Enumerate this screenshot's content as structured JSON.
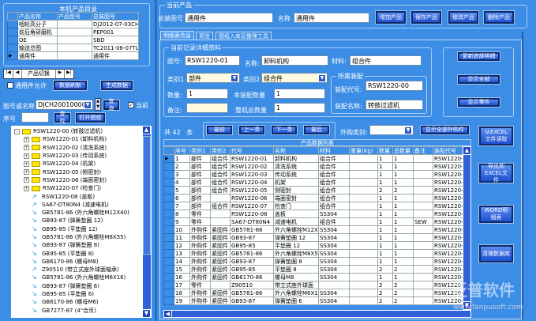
{
  "product_catalog": {
    "title": "本机产品目录",
    "headers": [
      "产品名称",
      "产品型号",
      "总装图号"
    ],
    "rows": [
      [
        "咽轮高分子",
        "",
        "DJ2012-07-03CH"
      ],
      [
        "前后角研磨机",
        "",
        "PEP001"
      ],
      [
        "OE",
        "",
        "SBD"
      ],
      [
        "输送总图",
        "",
        "TC2011-06-07TL"
      ],
      [
        "通用件",
        "",
        "通用件"
      ]
    ]
  },
  "nav": {
    "label": "产品切换",
    "first": "|◀",
    "prev": "◀",
    "next": "▶",
    "last": "▶|"
  },
  "common_parts": {
    "checkbox_label": "通用件允许",
    "checked": false,
    "refresh": "数据刷新",
    "generate": "生成数据"
  },
  "search": {
    "label": "图号或名称",
    "value": "DJCH20010000",
    "query": "查询",
    "current_label": "当前",
    "current_checked": true,
    "seq_label": "序号",
    "seq_value": "",
    "find": "查找",
    "open_drawing": "打开图纸"
  },
  "tree": [
    {
      "t": "folder",
      "exp": "-",
      "d": 0,
      "text": "RSW1220-00 (转鼓过滤机)"
    },
    {
      "t": "folder",
      "exp": "+",
      "d": 1,
      "text": "RSW1220-01 (卸料机构)"
    },
    {
      "t": "folder",
      "exp": "+",
      "d": 1,
      "text": "RSW1220-02 (清洗系统)"
    },
    {
      "t": "folder",
      "exp": "+",
      "d": 1,
      "text": "RSW1220-03 (传动系统)"
    },
    {
      "t": "folder",
      "exp": "+",
      "d": 1,
      "text": "RSW1220-04 (机架)"
    },
    {
      "t": "folder",
      "exp": "+",
      "d": 1,
      "text": "RSW1220-05 (侧密封)"
    },
    {
      "t": "folder",
      "exp": "+",
      "d": 1,
      "text": "RSW1220-06 (端面密封)"
    },
    {
      "t": "folder",
      "exp": "+",
      "d": 1,
      "text": "RSW1220-07 (检查门)"
    },
    {
      "t": "part",
      "d": 1,
      "text": "RSW1220-08 (盖板)"
    },
    {
      "t": "part",
      "d": 1,
      "text": "SA67-DT80N4 (减速电机)"
    },
    {
      "t": "std",
      "d": 1,
      "text": "GB5781-86 (外六角螺栓M12X40)"
    },
    {
      "t": "std",
      "d": 1,
      "text": "GB93-87 (弹簧垫圈 12)"
    },
    {
      "t": "std",
      "d": 1,
      "text": "GB95-85 (平垫圈 12)"
    },
    {
      "t": "std",
      "d": 1,
      "text": "GB5781-86 (外六角螺栓M8X55)"
    },
    {
      "t": "std",
      "d": 1,
      "text": "GB93-87 (弹簧垫圈 8)"
    },
    {
      "t": "std",
      "d": 1,
      "text": "GB95-85 (平垫圈 8)"
    },
    {
      "t": "std",
      "d": 1,
      "text": "GB6170-86 (螺母M8)"
    },
    {
      "t": "part",
      "d": 1,
      "text": "Z90510 (带立式座外球面轴承)"
    },
    {
      "t": "std",
      "d": 1,
      "text": "GB5781-86 (外六角螺栓M6X16)"
    },
    {
      "t": "std",
      "d": 1,
      "text": "GB93-87 (弹簧垫圈 6)"
    },
    {
      "t": "std",
      "d": 1,
      "text": "GB95-85 (平垫圈 6)"
    },
    {
      "t": "std",
      "d": 1,
      "text": "GB6170-86 (螺母M6)"
    },
    {
      "t": "std",
      "d": 1,
      "text": "GB7277-87 (4\"合页)"
    }
  ],
  "current_product": {
    "title": "当前产品",
    "drawing_label": "总装图号",
    "drawing_value": "通用件",
    "name_label": "名称",
    "name_value": "通用件",
    "add": "增加产品",
    "save": "保存产品",
    "modify": "修改产品",
    "delete": "删除产品"
  },
  "tabs": [
    "明细表信息",
    "预览",
    "图纸入库及整理工具"
  ],
  "detail": {
    "title": "当前记录详细资料",
    "drawing_label": "图号:",
    "drawing": "RSW1220-01",
    "name_label": "名称:",
    "name": "卸料机构",
    "material_label": "材料:",
    "material": "组合件",
    "cat1_label": "类别1",
    "cat1": "部件",
    "cat2_label": "类别2",
    "cat2": "组合件",
    "qty_label": "数量:",
    "qty": "1",
    "asm_qty_label": "本装配数量",
    "asm_qty": "1",
    "remark_label": "备注:",
    "remark": "",
    "total_label": "整机总数量",
    "total": "1",
    "assembly": {
      "title": "所属装配",
      "code_label": "装配代号:",
      "code": "RSW1220-00",
      "name_label": "装配名称:",
      "name": "转鼓过滤机"
    }
  },
  "side_buttons": [
    "更新选择明细",
    "显示全部",
    "显示零件"
  ],
  "toolbar": {
    "count_prefix": "共",
    "count": "42",
    "count_suffix": "条",
    "first": "最前",
    "prev": "上一条",
    "next": "下一条",
    "last": "最后",
    "purchase_label": "外购类别:",
    "purchase_value": "",
    "show_all": "显示全部外购件"
  },
  "grid": {
    "title": "产品数据列表",
    "headers": [
      "序号",
      "类别1",
      "类别2",
      "代号",
      "名称",
      "材料",
      "重量(Kg)",
      "数量",
      "总数量",
      "备注",
      "装配代号"
    ],
    "rows": [
      [
        "1",
        "部件",
        "组合件",
        "RSW1220-01",
        "卸料机构",
        "组合件",
        "",
        "1",
        "1",
        "",
        "RSW1220-00"
      ],
      [
        "2",
        "部件",
        "组合件",
        "RSW1220-02",
        "清洗系统",
        "组合件",
        "",
        "1",
        "1",
        "",
        "RSW1220-00"
      ],
      [
        "3",
        "部件",
        "组合件",
        "RSW1220-03",
        "传动系统",
        "组合件",
        "",
        "1",
        "1",
        "",
        "RSW1220-00"
      ],
      [
        "4",
        "部件",
        "组合件",
        "RSW1220-04",
        "机架",
        "组合件",
        "",
        "1",
        "1",
        "",
        "RSW1220-00"
      ],
      [
        "5",
        "部件",
        "组合件",
        "RSW1220-05",
        "侧密封",
        "组合件",
        "",
        "2",
        "2",
        "",
        "RSW1220-00"
      ],
      [
        "6",
        "部件",
        "",
        "RSW1220-06",
        "端面密封",
        "组合件",
        "",
        "1",
        "1",
        "",
        "RSW1220-00"
      ],
      [
        "7",
        "部件",
        "组合件",
        "RSW1220-07",
        "检查门",
        "组合件",
        "",
        "1",
        "1",
        "",
        "RSW1220-00"
      ],
      [
        "8",
        "零件",
        "",
        "RSW1220-08",
        "盖板",
        "SS304",
        "",
        "1",
        "1",
        "",
        "RSW1220-00"
      ],
      [
        "9",
        "零件",
        "",
        "SA67-DT80N4",
        "减速电机",
        "组合件",
        "",
        "1",
        "1",
        "SEW",
        "RSW1220-00"
      ],
      [
        "10",
        "外购件",
        "紧固件",
        "GB5781-86",
        "外六角螺栓M12X",
        "SS304",
        "",
        "1",
        "1",
        "",
        "RSW1220-00"
      ],
      [
        "11",
        "外购件",
        "紧固件",
        "GB93-87",
        "弹簧垫圈 12",
        "SS304",
        "",
        "1",
        "1",
        "",
        "RSW1220-00"
      ],
      [
        "12",
        "外购件",
        "紧固件",
        "GB95-85",
        "平垫圈 12",
        "SS304",
        "",
        "1",
        "1",
        "",
        "RSW1220-00"
      ],
      [
        "13",
        "外购件",
        "紧固件",
        "GB5781-86",
        "外六角螺栓M8X5",
        "SS304",
        "",
        "1",
        "1",
        "",
        "RSW1220-00"
      ],
      [
        "14",
        "外购件",
        "紧固件",
        "GB93-87",
        "弹簧垫圈 8",
        "SS304",
        "",
        "1",
        "1",
        "",
        "RSW1220-00"
      ],
      [
        "15",
        "外购件",
        "紧固件",
        "GB95-85",
        "平垫圈 8",
        "SS304",
        "",
        "2",
        "2",
        "",
        "RSW1220-00"
      ],
      [
        "16",
        "外购件",
        "紧固件",
        "GB6170-86",
        "螺母M8",
        "SS304",
        "",
        "1",
        "1",
        "",
        "RSW1220-00"
      ],
      [
        "17",
        "零件",
        "",
        "Z90510",
        "带立式座外球面",
        "",
        "",
        "2",
        "2",
        "",
        "RSW1220-00"
      ],
      [
        "18",
        "外购件",
        "紧固件",
        "GB5781-86",
        "外六角螺栓M6X1",
        "SS304",
        "",
        "2",
        "2",
        "",
        "RSW1220-00"
      ],
      [
        "19",
        "外购件",
        "紧固件",
        "GB93-87",
        "弹簧垫圈 6",
        "SS304",
        "",
        "2",
        "2",
        "",
        "RSW1220-00"
      ]
    ]
  },
  "right_buttons": [
    "从EXCEL文件读取",
    "导出到EXCEL文件",
    "WORD明细表",
    "清理数据库"
  ],
  "watermark": {
    "brand": "泛普软件",
    "url": "www.fanpusoft.com"
  }
}
